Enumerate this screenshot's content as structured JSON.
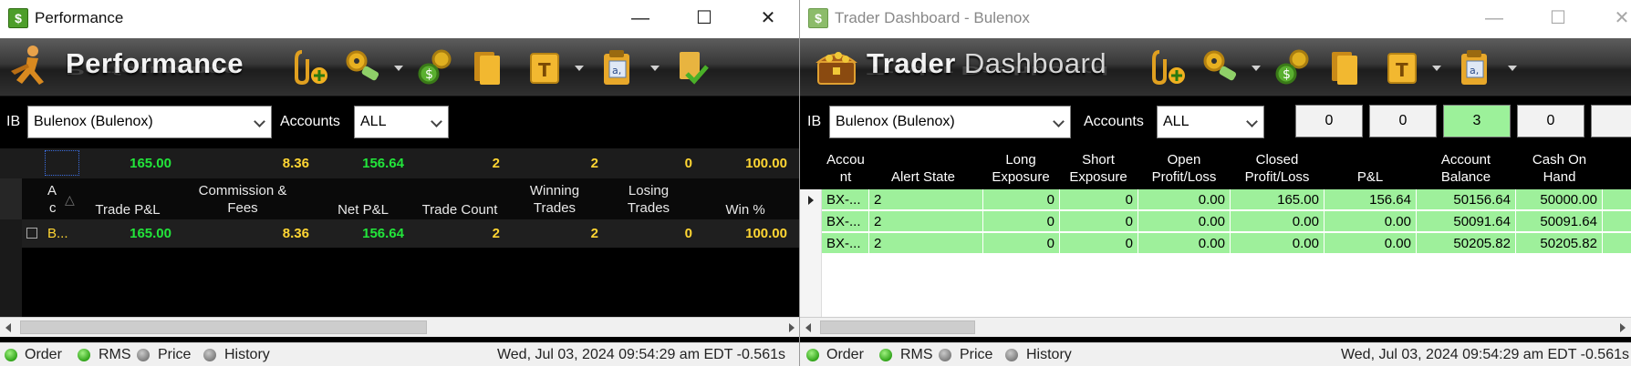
{
  "colors": {
    "green": "#22e53a",
    "yellow": "#ffd633",
    "row_green": "#9ef09b"
  },
  "performance": {
    "title": "Performance",
    "logo_text": "Performance",
    "ib_label": "IB",
    "ib_value": "Bulenox (Bulenox)",
    "accounts_label": "Accounts",
    "accounts_value": "ALL",
    "summary": {
      "trade_pnl": "165.00",
      "commission": "8.36",
      "net_pnl": "156.64",
      "trade_count": "2",
      "winning": "2",
      "losing": "0",
      "win_pct": "100.00"
    },
    "headers": {
      "account_a": "A",
      "account_c": "c",
      "trade_pnl": "Trade P&L",
      "commission_1": "Commission &",
      "commission_2": "Fees",
      "net_pnl": "Net P&L",
      "trade_count": "Trade Count",
      "winning_1": "Winning",
      "winning_2": "Trades",
      "losing_1": "Losing",
      "losing_2": "Trades",
      "win_pct": "Win %"
    },
    "row": {
      "account": "B...",
      "trade_pnl": "165.00",
      "commission": "8.36",
      "net_pnl": "156.64",
      "trade_count": "2",
      "winning": "2",
      "losing": "0",
      "win_pct": "100.00"
    },
    "status": {
      "order": "Order",
      "rms": "RMS",
      "price": "Price",
      "history": "History",
      "time": "Wed, Jul 03, 2024 09:54:29 am EDT -0.561s"
    }
  },
  "dashboard": {
    "title": "Trader Dashboard - Bulenox",
    "logo_text_bold": "Trader",
    "logo_text_thin": "Dashboard",
    "ib_label": "IB",
    "ib_value": "Bulenox (Bulenox)",
    "accounts_label": "Accounts",
    "accounts_value": "ALL",
    "counts": [
      "0",
      "0",
      "3",
      "0"
    ],
    "headers": {
      "account_1": "Accou",
      "account_2": "nt",
      "alert": "Alert State",
      "long_1": "Long",
      "long_2": "Exposure",
      "short_1": "Short",
      "short_2": "Exposure",
      "open_1": "Open",
      "open_2": "Profit/Loss",
      "closed_1": "Closed",
      "closed_2": "Profit/Loss",
      "pnl": "P&L",
      "balance_1": "Account",
      "balance_2": "Balance",
      "cash_1": "Cash On",
      "cash_2": "Hand"
    },
    "rows": [
      {
        "account": "BX-...",
        "alert": "2",
        "long": "0",
        "short": "0",
        "open": "0.00",
        "closed": "165.00",
        "pnl": "156.64",
        "balance": "50156.64",
        "cash": "50000.00"
      },
      {
        "account": "BX-...",
        "alert": "2",
        "long": "0",
        "short": "0",
        "open": "0.00",
        "closed": "0.00",
        "pnl": "0.00",
        "balance": "50091.64",
        "cash": "50091.64"
      },
      {
        "account": "BX-...",
        "alert": "2",
        "long": "0",
        "short": "0",
        "open": "0.00",
        "closed": "0.00",
        "pnl": "0.00",
        "balance": "50205.82",
        "cash": "50205.82"
      }
    ],
    "status": {
      "order": "Order",
      "rms": "RMS",
      "price": "Price",
      "history": "History",
      "time": "Wed, Jul 03, 2024 09:54:29 am EDT -0.561s"
    }
  }
}
